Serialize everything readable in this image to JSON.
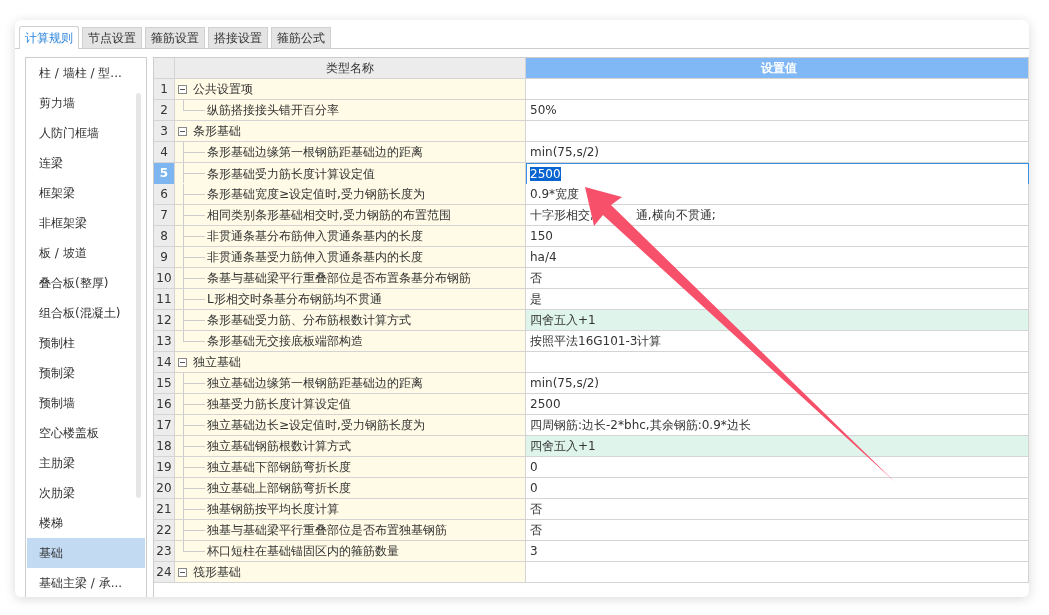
{
  "tabs": [
    {
      "label": "计算规则",
      "selected": true
    },
    {
      "label": "节点设置",
      "selected": false
    },
    {
      "label": "箍筋设置",
      "selected": false
    },
    {
      "label": "搭接设置",
      "selected": false
    },
    {
      "label": "箍筋公式",
      "selected": false
    }
  ],
  "sidebar": {
    "items": [
      {
        "label": "柱 / 墙柱 / 型...",
        "selected": false
      },
      {
        "label": "剪力墙",
        "selected": false
      },
      {
        "label": "人防门框墙",
        "selected": false
      },
      {
        "label": "连梁",
        "selected": false
      },
      {
        "label": "框架梁",
        "selected": false
      },
      {
        "label": "非框架梁",
        "selected": false
      },
      {
        "label": "板 / 坡道",
        "selected": false
      },
      {
        "label": "叠合板(整厚)",
        "selected": false
      },
      {
        "label": "组合板(混凝土)",
        "selected": false
      },
      {
        "label": "预制柱",
        "selected": false
      },
      {
        "label": "预制梁",
        "selected": false
      },
      {
        "label": "预制墙",
        "selected": false
      },
      {
        "label": "空心楼盖板",
        "selected": false
      },
      {
        "label": "主肋梁",
        "selected": false
      },
      {
        "label": "次肋梁",
        "selected": false
      },
      {
        "label": "楼梯",
        "selected": false
      },
      {
        "label": "基础",
        "selected": true
      },
      {
        "label": "基础主梁 / 承...",
        "selected": false
      }
    ]
  },
  "table": {
    "columns": [
      "类型名称",
      "设置值"
    ],
    "groups": [
      {
        "number": "1",
        "name": "公共设置项",
        "expanded": true,
        "selected": false,
        "children": [
          {
            "number": "2",
            "name": "纵筋搭接接头错开百分率",
            "value": "50%",
            "selected": false,
            "highlighted": false
          }
        ]
      },
      {
        "number": "3",
        "name": "条形基础",
        "expanded": true,
        "selected": false,
        "children": [
          {
            "number": "4",
            "name": "条形基础边缘第一根钢筋距基础边的距离",
            "value": "min(75,s/2)",
            "selected": false,
            "highlighted": false
          },
          {
            "number": "5",
            "name": "条形基础受力筋长度计算设定值",
            "value": "2500",
            "selected": true,
            "highlighted": false
          },
          {
            "number": "6",
            "name": "条形基础宽度≥设定值时,受力钢筋长度为",
            "value": "0.9*宽度",
            "selected": false,
            "highlighted": false
          },
          {
            "number": "7",
            "name": "相同类别条形基础相交时,受力钢筋的布置范围",
            "value_parts": [
              "十字形相交,",
              "通,横向不贯通;"
            ],
            "selected": false,
            "highlighted": false
          },
          {
            "number": "8",
            "name": "非贯通条基分布筋伸入贯通条基内的长度",
            "value": "150",
            "selected": false,
            "highlighted": false
          },
          {
            "number": "9",
            "name": "非贯通条基受力筋伸入贯通条基内的长度",
            "value": "ha/4",
            "selected": false,
            "highlighted": false
          },
          {
            "number": "10",
            "name": "条基与基础梁平行重叠部位是否布置条基分布钢筋",
            "value": "否",
            "selected": false,
            "highlighted": false
          },
          {
            "number": "11",
            "name": "L形相交时条基分布钢筋均不贯通",
            "value": "是",
            "selected": false,
            "highlighted": false
          },
          {
            "number": "12",
            "name": "条形基础受力筋、分布筋根数计算方式",
            "value": "四舍五入+1",
            "selected": false,
            "highlighted": true
          },
          {
            "number": "13",
            "name": "条形基础无交接底板端部构造",
            "value": "按照平法16G101-3计算",
            "selected": false,
            "highlighted": false
          }
        ]
      },
      {
        "number": "14",
        "name": "独立基础",
        "expanded": true,
        "selected": false,
        "children": [
          {
            "number": "15",
            "name": "独立基础边缘第一根钢筋距基础边的距离",
            "value": "min(75,s/2)",
            "selected": false,
            "highlighted": false
          },
          {
            "number": "16",
            "name": "独基受力筋长度计算设定值",
            "value": "2500",
            "selected": false,
            "highlighted": false
          },
          {
            "number": "17",
            "name": "独立基础边长≥设定值时,受力钢筋长度为",
            "value": "四周钢筋:边长-2*bhc,其余钢筋:0.9*边长",
            "selected": false,
            "highlighted": false
          },
          {
            "number": "18",
            "name": "独立基础钢筋根数计算方式",
            "value": "四舍五入+1",
            "selected": false,
            "highlighted": true
          },
          {
            "number": "19",
            "name": "独立基础下部钢筋弯折长度",
            "value": "0",
            "selected": false,
            "highlighted": false
          },
          {
            "number": "20",
            "name": "独立基础上部钢筋弯折长度",
            "value": "0",
            "selected": false,
            "highlighted": false
          },
          {
            "number": "21",
            "name": "独基钢筋按平均长度计算",
            "value": "否",
            "selected": false,
            "highlighted": false
          },
          {
            "number": "22",
            "name": "独基与基础梁平行重叠部位是否布置独基钢筋",
            "value": "否",
            "selected": false,
            "highlighted": false
          },
          {
            "number": "23",
            "name": "杯口短柱在基础锚固区内的箍筋数量",
            "value": "3",
            "selected": false,
            "highlighted": false
          }
        ]
      },
      {
        "number": "24",
        "name": "筏形基础",
        "expanded": true,
        "selected": false
      }
    ]
  }
}
